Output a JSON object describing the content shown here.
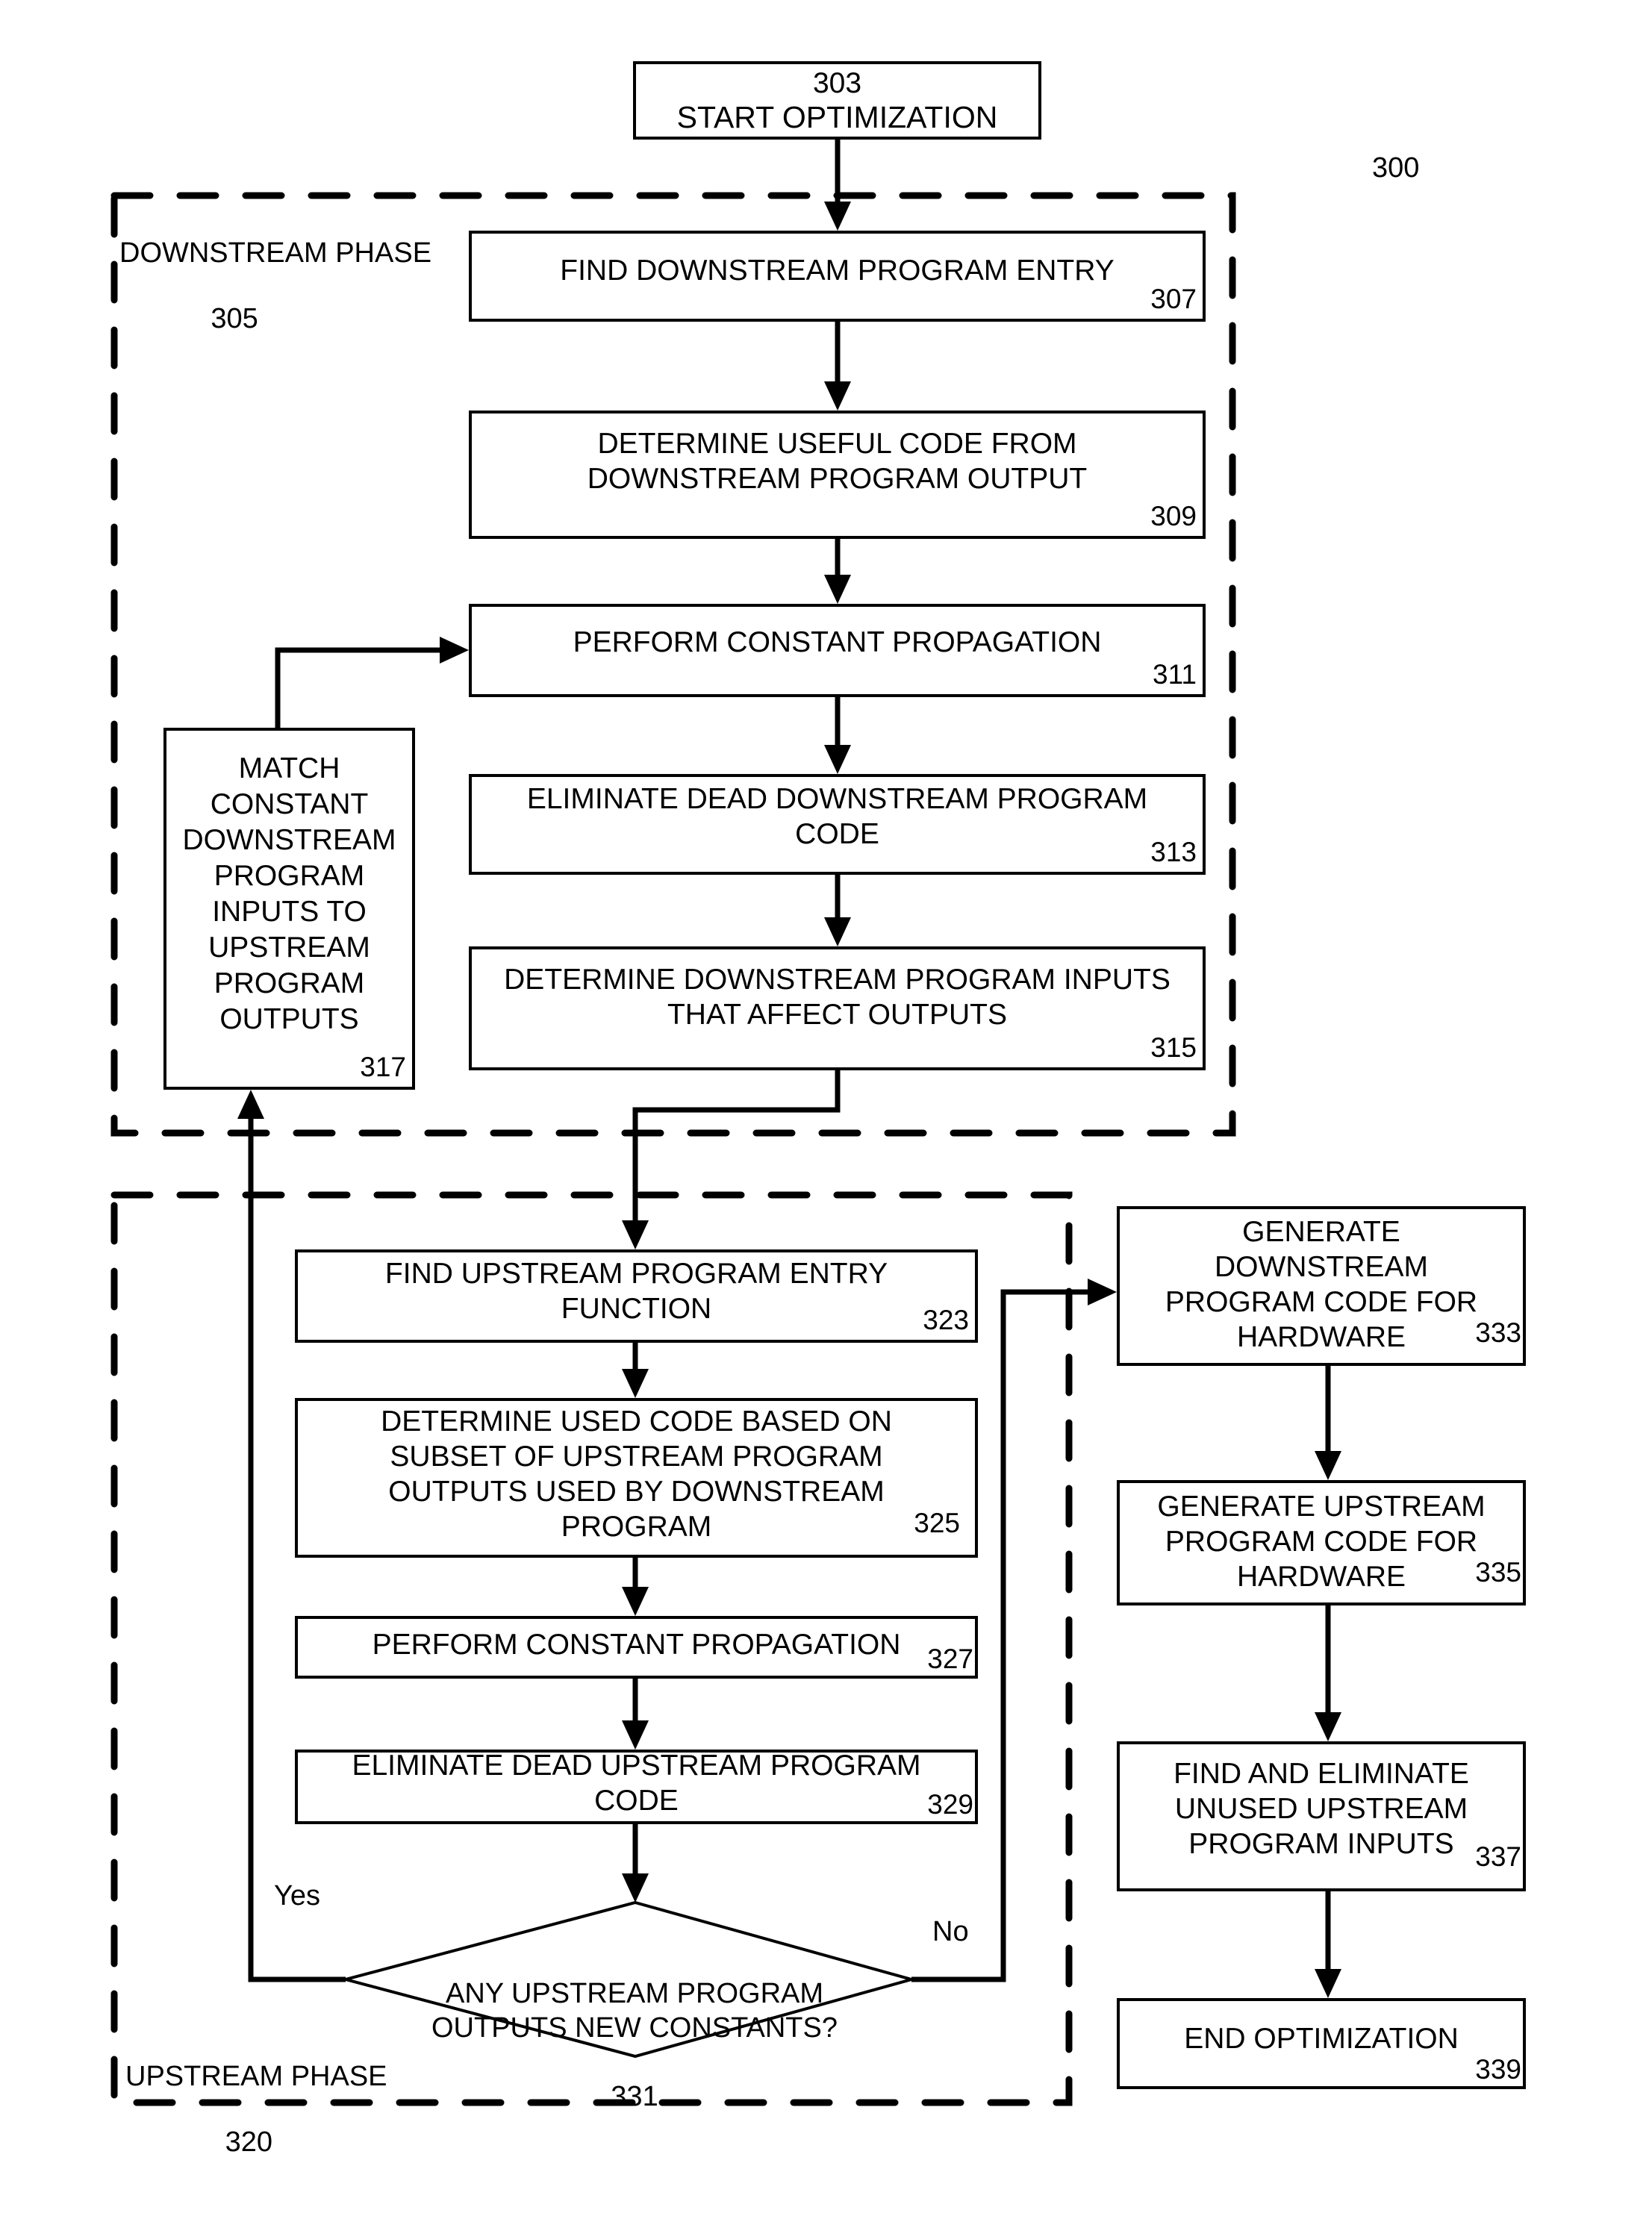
{
  "figure": {
    "ref": "300",
    "start": {
      "num": "303",
      "label": "START OPTIMIZATION"
    },
    "downstream_phase": {
      "label": "DOWNSTREAM PHASE",
      "num": "305",
      "steps": [
        {
          "num": "307",
          "label": "FIND DOWNSTREAM PROGRAM ENTRY"
        },
        {
          "num": "309",
          "label": "DETERMINE USEFUL CODE FROM\nDOWNSTREAM PROGRAM OUTPUT"
        },
        {
          "num": "311",
          "label": "PERFORM CONSTANT PROPAGATION"
        },
        {
          "num": "313",
          "label": "ELIMINATE DEAD DOWNSTREAM PROGRAM\nCODE"
        },
        {
          "num": "315",
          "label": "DETERMINE DOWNSTREAM PROGRAM INPUTS\nTHAT AFFECT OUTPUTS"
        }
      ],
      "match": {
        "num": "317",
        "label": "MATCH\nCONSTANT\nDOWNSTREAM\nPROGRAM\nINPUTS TO\nUPSTREAM\nPROGRAM\nOUTPUTS"
      }
    },
    "upstream_phase": {
      "label": "UPSTREAM PHASE",
      "num": "320",
      "steps": [
        {
          "num": "323",
          "label": "FIND UPSTREAM PROGRAM ENTRY\nFUNCTION"
        },
        {
          "num": "325",
          "label": "DETERMINE USED CODE BASED ON\nSUBSET OF UPSTREAM PROGRAM\nOUTPUTS USED BY DOWNSTREAM\nPROGRAM"
        },
        {
          "num": "327",
          "label": "PERFORM CONSTANT PROPAGATION"
        },
        {
          "num": "329",
          "label": "ELIMINATE DEAD UPSTREAM PROGRAM\nCODE"
        }
      ],
      "decision": {
        "num": "331",
        "label": "ANY UPSTREAM PROGRAM\nOUTPUTS NEW CONSTANTS?",
        "yes": "Yes",
        "no": "No"
      }
    },
    "final_steps": [
      {
        "num": "333",
        "label": "GENERATE\nDOWNSTREAM\nPROGRAM CODE FOR\nHARDWARE"
      },
      {
        "num": "335",
        "label": "GENERATE UPSTREAM\nPROGRAM CODE FOR\nHARDWARE"
      },
      {
        "num": "337",
        "label": "FIND AND ELIMINATE\nUNUSED UPSTREAM\nPROGRAM INPUTS"
      },
      {
        "num": "339",
        "label": "END OPTIMIZATION"
      }
    ]
  }
}
